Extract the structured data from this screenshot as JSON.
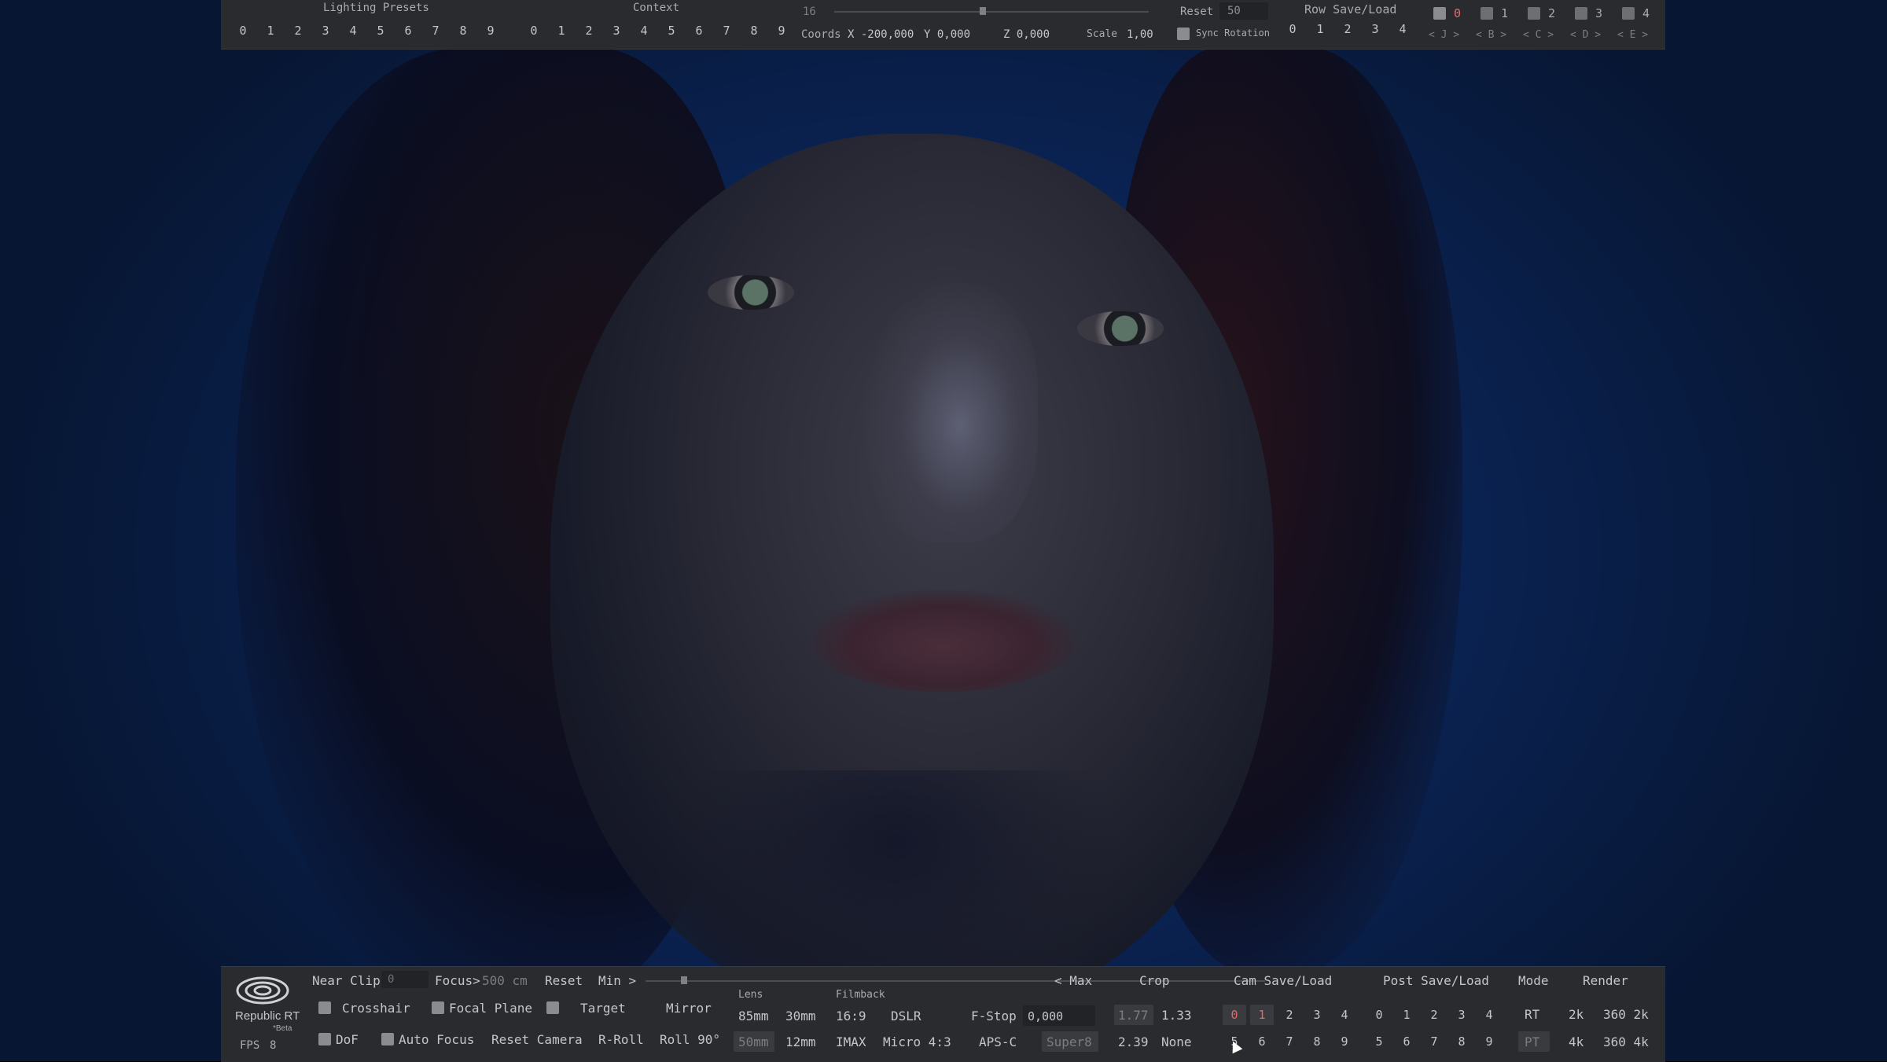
{
  "top": {
    "lighting_presets_label": "Lighting Presets",
    "lighting_presets": [
      "0",
      "1",
      "2",
      "3",
      "4",
      "5",
      "6",
      "7",
      "8",
      "9"
    ],
    "context_label": "Context",
    "context": [
      "0",
      "1",
      "2",
      "3",
      "4",
      "5",
      "6",
      "7",
      "8",
      "9"
    ],
    "slider_value": "16",
    "coords_label": "Coords",
    "x": "X  -200,000",
    "y": "Y  0,000",
    "z": "Z  0,000",
    "scale_label": "Scale",
    "scale_value": "1,00",
    "reset_label": "Reset",
    "reset_value": "50",
    "sync_rotation_label": "Sync Rotation",
    "row_save_load_label": "Row Save/Load",
    "row_save_load": [
      "0",
      "1",
      "2",
      "3",
      "4"
    ],
    "slots": [
      {
        "num": "0",
        "nav": "< J >",
        "active": true
      },
      {
        "num": "1",
        "nav": "< B >",
        "active": false
      },
      {
        "num": "2",
        "nav": "< C >",
        "active": false
      },
      {
        "num": "3",
        "nav": "< D >",
        "active": false
      },
      {
        "num": "4",
        "nav": "< E >",
        "active": false
      }
    ]
  },
  "bottom": {
    "logo_name": "Republic RT",
    "logo_sub": "*Beta",
    "fps_label": "FPS",
    "fps_value": "8",
    "near_clip_label": "Near Clip",
    "near_clip_value": "0",
    "focus_label": "Focus>",
    "focus_value": "500 cm",
    "reset_label": "Reset",
    "min_label": "Min >",
    "max_label": "< Max",
    "crosshair": "Crosshair",
    "focal_plane": "Focal Plane",
    "target": "Target",
    "mirror": "Mirror",
    "dof": "DoF",
    "auto_focus": "Auto Focus",
    "reset_camera": "Reset Camera",
    "r_roll": "R-Roll",
    "roll_90": "Roll 90°",
    "lens_label": "Lens",
    "lens": [
      "85mm",
      "30mm",
      "50mm",
      "12mm"
    ],
    "filmback_label": "Filmback",
    "filmback": [
      "16:9",
      "DSLR",
      "IMAX",
      "Micro 4:3",
      "APS-C",
      "Super8"
    ],
    "fstop_label": "F-Stop",
    "fstop_value": "0,000",
    "crop_label": "Crop",
    "crop": [
      "1.77",
      "1.33",
      "2.39",
      "None"
    ],
    "cam_save_load_label": "Cam Save/Load",
    "cam_save_load": [
      "0",
      "1",
      "2",
      "3",
      "4",
      "5",
      "6",
      "7",
      "8",
      "9"
    ],
    "post_save_load_label": "Post Save/Load",
    "post_save_load": [
      "0",
      "1",
      "2",
      "3",
      "4",
      "5",
      "6",
      "7",
      "8",
      "9"
    ],
    "mode_label": "Mode",
    "mode": [
      "RT",
      "PT"
    ],
    "render_label": "Render",
    "render": [
      "2k",
      "360 2k",
      "4k",
      "360 4k"
    ]
  },
  "colors": {
    "panel": "#2a2b2e",
    "active_red": "#e26a6a",
    "background_blue": "#0b2558"
  }
}
